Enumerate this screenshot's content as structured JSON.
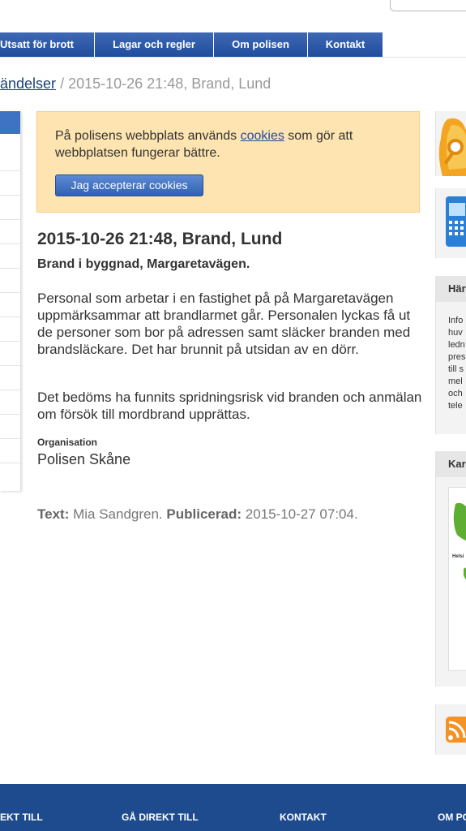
{
  "nav": {
    "items": [
      {
        "label": "Utsatt för brott"
      },
      {
        "label": "Lagar och regler"
      },
      {
        "label": "Om polisen"
      },
      {
        "label": "Kontakt"
      }
    ]
  },
  "breadcrumb": {
    "link": "ändelser",
    "separator": "/",
    "current": "2015-10-26 21:48, Brand, Lund"
  },
  "cookie_notice": {
    "text_before": "På polisens webbplats används ",
    "link": "cookies",
    "text_after": " som gör att webbplatsen fungerar bättre.",
    "button": "Jag accepterar cookies"
  },
  "article": {
    "title": "2015-10-26 21:48, Brand, Lund",
    "subtitle": "Brand i byggnad, Margaretavägen.",
    "paragraphs": [
      "Personal som arbetar i en fastighet på på Margaretavägen uppmärksammar att brandlarmet går. Personalen lyckas få ut de personer som bor på adressen samt släcker branden med brandsläckare. Det har brunnit på utsidan av en dörr.",
      "Det bedöms ha funnits spridningsrisk vid branden och anmälan om försök till mordbrand upprättas."
    ],
    "org_label": "Organisation",
    "org_value": "Polisen Skåne",
    "text_label": "Text:",
    "author": "Mia Sandgren.",
    "published_label": "Publicerad:",
    "published": "2015-10-27 07:04."
  },
  "sidebar": {
    "box1_title": "Här",
    "box1_lines": [
      "Info",
      "huv",
      "ledn",
      "pres",
      "till s",
      "mel",
      "och",
      "tele"
    ],
    "box2_title": "Kar",
    "map_label": "Helsi"
  },
  "footer": {
    "items": [
      "EKT TILL",
      "GÅ DIREKT TILL",
      "KONTAKT",
      "OM PO"
    ]
  },
  "colors": {
    "nav_blue": "#2a56a6",
    "cookie_bg": "#fde4b0",
    "footer_blue": "#1e4b8e",
    "link_blue": "#2a4a9c"
  }
}
